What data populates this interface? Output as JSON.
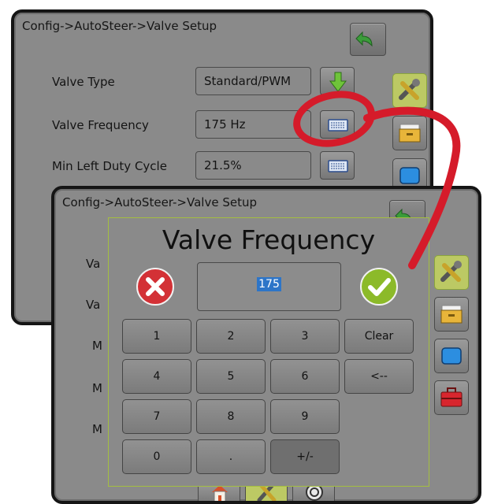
{
  "back_screen": {
    "breadcrumb": "Config->AutoSteer->Valve Setup",
    "rows": [
      {
        "label": "Valve Type",
        "value": "Standard/PWM",
        "button": "down-arrow-icon"
      },
      {
        "label": "Valve Frequency",
        "value": "175 Hz",
        "button": "keyboard-icon"
      },
      {
        "label": "Min Left Duty Cycle",
        "value": "21.5%",
        "button": "keyboard-icon"
      }
    ]
  },
  "front_screen": {
    "breadcrumb": "Config->AutoSteer->Valve Setup",
    "hidden_labels": [
      "Va",
      "Va",
      "M",
      "M",
      "M"
    ]
  },
  "dialog": {
    "title": "Valve Frequency",
    "value": "175",
    "keys": [
      [
        "1",
        "2",
        "3",
        "Clear"
      ],
      [
        "4",
        "5",
        "6",
        "<--"
      ],
      [
        "7",
        "8",
        "9",
        ""
      ],
      [
        "0",
        ".",
        "+/-",
        ""
      ]
    ]
  },
  "colors": {
    "screen_bg": "#8a8a8a",
    "accent_green": "#a4bf40",
    "cancel_red": "#d33136",
    "confirm_green": "#8cba29",
    "annotation_red": "#d51b2a",
    "selection_blue": "#2d75c8"
  }
}
